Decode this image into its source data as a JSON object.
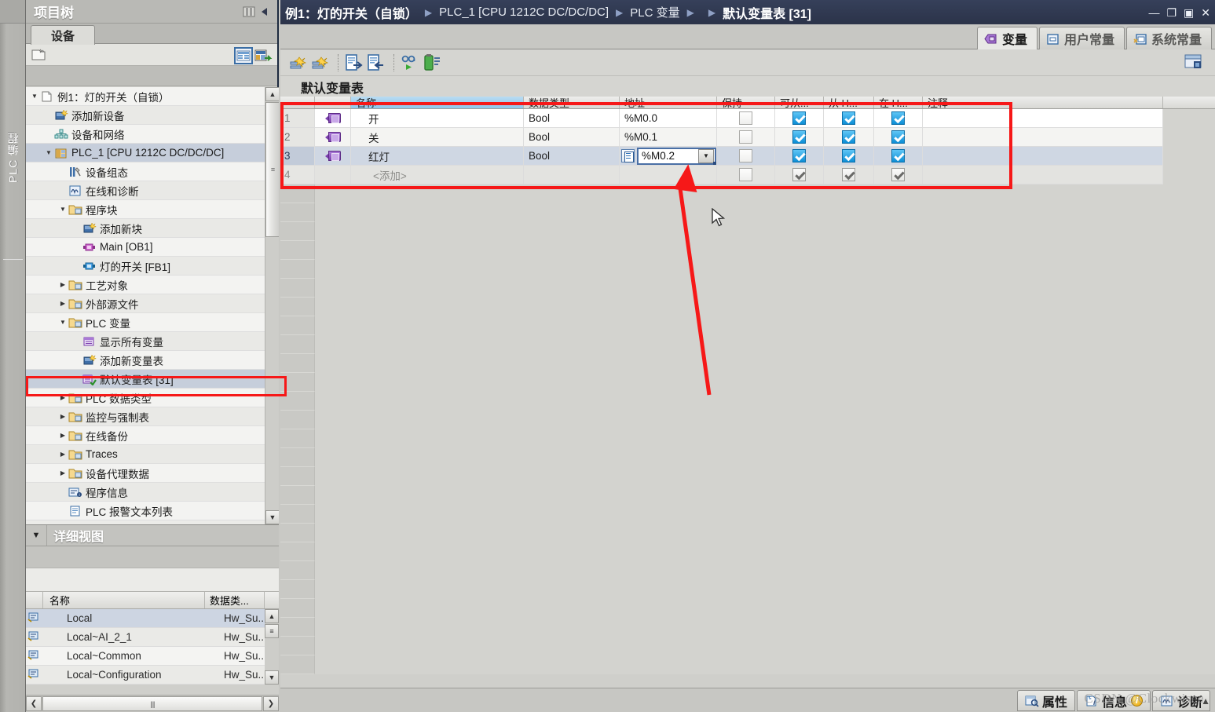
{
  "app": {
    "vertical_bar_label": "PLC 编程",
    "watermark": "CSDN @Clockwisee"
  },
  "titlebar": {
    "crumbs": [
      {
        "text": "例1：灯的开关（自锁）",
        "bold": true
      },
      {
        "text": "PLC_1 [CPU 1212C DC/DC/DC]",
        "bold": false
      },
      {
        "text": "PLC 变量",
        "bold": false
      },
      {
        "text": "默认变量表 [31]",
        "bold": true
      }
    ],
    "separator": "▶",
    "window_buttons": [
      "minimize",
      "restore",
      "maximize",
      "close"
    ],
    "minimize_glyph": "—",
    "restore_glyph": "❐",
    "maximize_glyph": "▣",
    "close_glyph": "✕"
  },
  "project_tree": {
    "title": "项目树",
    "tab": "设备",
    "toolbar": {
      "new_icon": "new-folder-icon",
      "overview_icon": "details-view-icon",
      "link_icon": "link-to-device-icon"
    },
    "items": [
      {
        "label": "例1：灯的开关（自锁）",
        "indent": 0,
        "twist": "▼",
        "icon": "project-icon",
        "selected": false
      },
      {
        "label": "添加新设备",
        "indent": 1,
        "twist": "",
        "icon": "add-device-icon",
        "selected": false
      },
      {
        "label": "设备和网络",
        "indent": 1,
        "twist": "",
        "icon": "devices-networks-icon",
        "selected": false
      },
      {
        "label": "PLC_1 [CPU 1212C DC/DC/DC]",
        "indent": 1,
        "twist": "▼",
        "icon": "plc-icon",
        "selected": true
      },
      {
        "label": "设备组态",
        "indent": 2,
        "twist": "",
        "icon": "device-config-icon",
        "selected": false
      },
      {
        "label": "在线和诊断",
        "indent": 2,
        "twist": "",
        "icon": "online-diagnostics-icon",
        "selected": false
      },
      {
        "label": "程序块",
        "indent": 2,
        "twist": "▼",
        "icon": "program-blocks-folder-icon",
        "selected": false
      },
      {
        "label": "添加新块",
        "indent": 3,
        "twist": "",
        "icon": "add-block-icon",
        "selected": false
      },
      {
        "label": "Main [OB1]",
        "indent": 3,
        "twist": "",
        "icon": "ob-block-icon",
        "selected": false
      },
      {
        "label": "灯的开关 [FB1]",
        "indent": 3,
        "twist": "",
        "icon": "fb-block-icon",
        "selected": false
      },
      {
        "label": "工艺对象",
        "indent": 2,
        "twist": "▶",
        "icon": "technology-objects-icon",
        "selected": false
      },
      {
        "label": "外部源文件",
        "indent": 2,
        "twist": "▶",
        "icon": "external-source-icon",
        "selected": false
      },
      {
        "label": "PLC 变量",
        "indent": 2,
        "twist": "▼",
        "icon": "plc-tags-folder-icon",
        "selected": false
      },
      {
        "label": "显示所有变量",
        "indent": 3,
        "twist": "",
        "icon": "show-all-tags-icon",
        "selected": false
      },
      {
        "label": "添加新变量表",
        "indent": 3,
        "twist": "",
        "icon": "add-tag-table-icon",
        "selected": false
      },
      {
        "label": "默认变量表 [31]",
        "indent": 3,
        "twist": "",
        "icon": "default-tag-table-icon",
        "selected": true
      },
      {
        "label": "PLC 数据类型",
        "indent": 2,
        "twist": "▶",
        "icon": "plc-data-types-icon",
        "selected": false
      },
      {
        "label": "监控与强制表",
        "indent": 2,
        "twist": "▶",
        "icon": "watch-force-tables-icon",
        "selected": false
      },
      {
        "label": "在线备份",
        "indent": 2,
        "twist": "▶",
        "icon": "online-backups-icon",
        "selected": false
      },
      {
        "label": "Traces",
        "indent": 2,
        "twist": "▶",
        "icon": "traces-icon",
        "selected": false
      },
      {
        "label": "设备代理数据",
        "indent": 2,
        "twist": "▶",
        "icon": "device-proxy-data-icon",
        "selected": false
      },
      {
        "label": "程序信息",
        "indent": 2,
        "twist": "",
        "icon": "program-info-icon",
        "selected": false
      },
      {
        "label": "PLC 报警文本列表",
        "indent": 2,
        "twist": "",
        "icon": "plc-alarm-text-list-icon",
        "selected": false
      }
    ],
    "scrollbar": {
      "up": "▲",
      "down": "▼",
      "grip": "≡"
    }
  },
  "detail_view": {
    "title": "详细视图",
    "caret": "▼",
    "columns": [
      "名称",
      "数据类..."
    ],
    "rows": [
      {
        "name": "Local",
        "type": "Hw_Su...",
        "selected": true
      },
      {
        "name": "Local~AI_2_1",
        "type": "Hw_Su...",
        "selected": false
      },
      {
        "name": "Local~Common",
        "type": "Hw_Su...",
        "selected": false
      },
      {
        "name": "Local~Configuration",
        "type": "Hw_Su...",
        "selected": false
      }
    ],
    "hscroll": {
      "left": "❮",
      "right": "❯",
      "grip": "||||"
    },
    "vscroll": {
      "up": "▲",
      "down": "▼",
      "grip": "≡"
    }
  },
  "main": {
    "tabs": [
      {
        "label": "变量",
        "icon": "tag-icon",
        "active": true
      },
      {
        "label": "用户常量",
        "icon": "user-constant-icon",
        "active": false
      },
      {
        "label": "系统常量",
        "icon": "system-constant-icon",
        "active": false
      }
    ],
    "toolbar": [
      {
        "name": "new-tag-icon"
      },
      {
        "name": "new-constant-icon"
      },
      {
        "name": "export-icon"
      },
      {
        "name": "import-icon"
      },
      {
        "name": "monitor-all-icon"
      },
      {
        "name": "retain-memory-icon"
      }
    ],
    "toolbar_right_icon": "column-settings-icon",
    "table_title": "默认变量表",
    "table": {
      "columns": [
        {
          "label": "名称",
          "sorted": true
        },
        {
          "label": "数据类型",
          "sorted": false
        },
        {
          "label": "地址",
          "sorted": false
        },
        {
          "label": "保持",
          "sorted": false
        },
        {
          "label": "可从...",
          "sorted": false
        },
        {
          "label": "从 H...",
          "sorted": false
        },
        {
          "label": "在 H...",
          "sorted": false
        },
        {
          "label": "注释",
          "sorted": false
        }
      ],
      "rows": [
        {
          "num": "1",
          "icon": "tag-icon",
          "name": "开",
          "type": "Bool",
          "address": "%M0.0",
          "retain": false,
          "hmi_access": true,
          "hmi_write": true,
          "hmi_visible": true,
          "comment": "",
          "state": "normal"
        },
        {
          "num": "2",
          "icon": "tag-icon",
          "name": "关",
          "type": "Bool",
          "address": "%M0.1",
          "retain": false,
          "hmi_access": true,
          "hmi_write": true,
          "hmi_visible": true,
          "comment": "",
          "state": "normal"
        },
        {
          "num": "3",
          "icon": "tag-icon",
          "name": "红灯",
          "type": "Bool",
          "address": "%M0.2",
          "retain": false,
          "hmi_access": true,
          "hmi_write": true,
          "hmi_visible": true,
          "comment": "",
          "state": "selected",
          "editing_address": true
        },
        {
          "num": "4",
          "icon": "",
          "name": "<添加>",
          "type": "",
          "address": "",
          "retain": false,
          "hmi_access": "gray",
          "hmi_write": "gray",
          "hmi_visible": "gray",
          "comment": "",
          "state": "add"
        }
      ],
      "address_editor": {
        "value": "%M0.2",
        "dropdown_glyph": "▼",
        "helper_icon": "address-helper-icon"
      }
    },
    "annotations": {
      "tree_highlight": "red-rectangle-around-default-tag-table",
      "grid_highlight": "red-rectangle-around-tag-rows",
      "arrow": "red-arrow-pointing-to-address-cell"
    }
  },
  "statusbar": {
    "tabs": [
      {
        "label": "属性",
        "icon": "properties-icon",
        "badge": ""
      },
      {
        "label": "信息",
        "icon": "info-icon",
        "badge": "i"
      },
      {
        "label": "诊断",
        "icon": "diagnostics-icon",
        "badge": ""
      }
    ],
    "expander": "▲"
  },
  "colors": {
    "titlebar_bg": "#2b3349",
    "accent_red": "#f61818",
    "checkbox_on": "#0d8ed6",
    "sorted_header": "#8fc6ec",
    "selection": "#cfd7e3",
    "panel_bg": "#cfcfcb"
  }
}
